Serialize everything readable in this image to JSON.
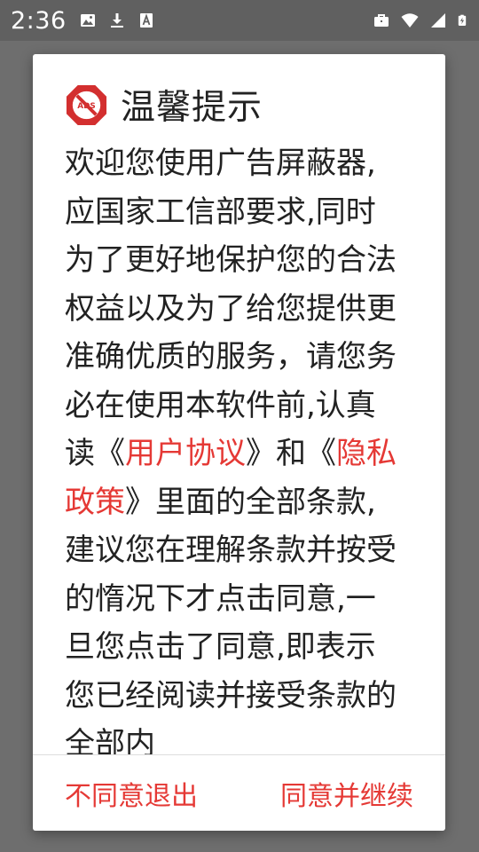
{
  "status_bar": {
    "time": "2:36",
    "icons": [
      "image-icon",
      "download-icon",
      "font-icon",
      "briefcase-icon",
      "wifi-icon",
      "signal-icon",
      "battery-charging-icon"
    ]
  },
  "dialog": {
    "icon": "no-ads-icon",
    "title": "温馨提示",
    "body": {
      "part1": "欢迎您使用广告屏蔽器,应国家工信部要求,同时为了更好地保护您的合法权益以及为了给您提供更准确优质的服务，请您务必在使用本软件前,认真读《",
      "link1": "用户协议",
      "part2": "》和《",
      "link2": "隐私政策",
      "part3": "》里面的全部条款,建议您在理解条款并按受的惰况下才点击同意,一旦您点击了同意,即表示您已经阅读并接受条款的全部内"
    },
    "decline_label": "不同意退出",
    "accept_label": "同意并继续"
  },
  "colors": {
    "accent": "#e53935",
    "scrim": "#6e6e6e",
    "status_bar": "#606060"
  }
}
